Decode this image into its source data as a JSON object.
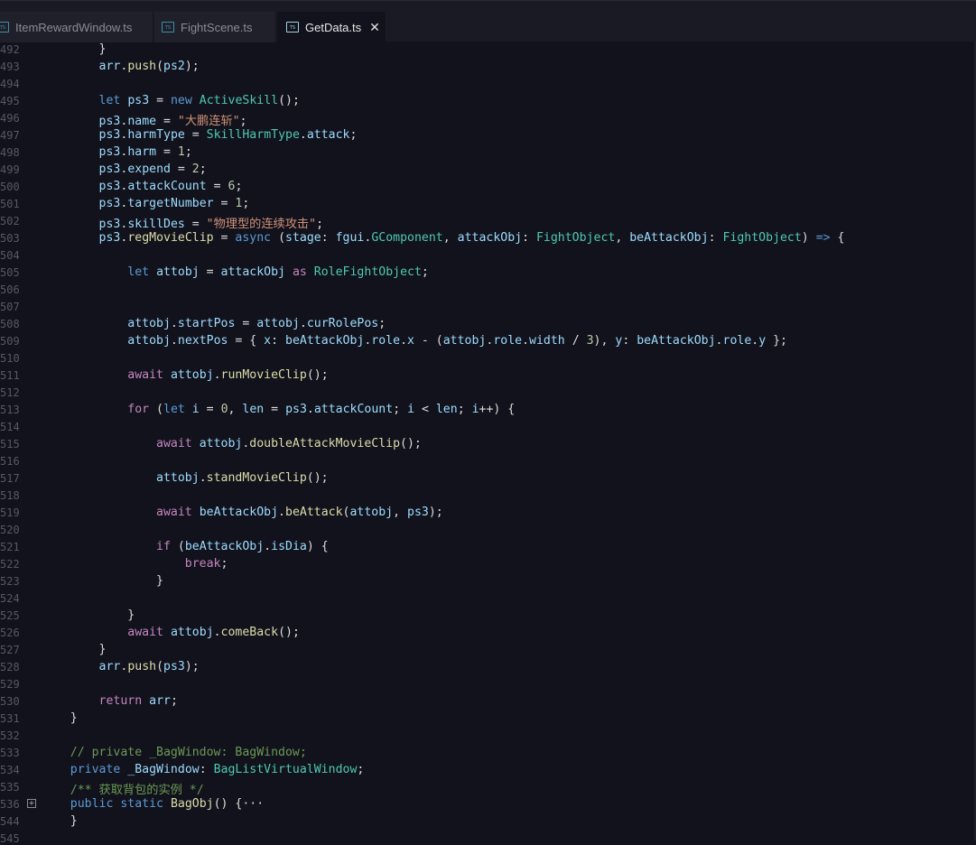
{
  "tabs": [
    {
      "label": "ItemRewardWindow.ts",
      "active": false
    },
    {
      "label": "FightScene.ts",
      "active": false
    },
    {
      "label": "GetData.ts",
      "active": true
    }
  ],
  "tab_icon_text": "TS",
  "close_symbol": "✕",
  "colors": {
    "background": "#12121c",
    "keyword": "#5b9bd5",
    "control": "#c586c0",
    "function": "#dcdcaa",
    "type": "#4ec9b0",
    "string": "#ce9178",
    "number": "#b5cea8",
    "comment": "#6a9955",
    "variable": "#9cdcfe"
  },
  "lines": [
    {
      "n": "492",
      "t": [
        [
          "pl",
          "        }"
        ]
      ]
    },
    {
      "n": "493",
      "t": [
        [
          "pl",
          "        "
        ],
        [
          "vr",
          "arr"
        ],
        [
          "pl",
          "."
        ],
        [
          "fn",
          "push"
        ],
        [
          "pl",
          "("
        ],
        [
          "vr",
          "ps2"
        ],
        [
          "pl",
          ");"
        ]
      ]
    },
    {
      "n": "494",
      "t": []
    },
    {
      "n": "495",
      "t": [
        [
          "pl",
          "        "
        ],
        [
          "kw",
          "let"
        ],
        [
          "pl",
          " "
        ],
        [
          "vr",
          "ps3"
        ],
        [
          "pl",
          " = "
        ],
        [
          "kw",
          "new"
        ],
        [
          "pl",
          " "
        ],
        [
          "ty",
          "ActiveSkill"
        ],
        [
          "pl",
          "();"
        ]
      ]
    },
    {
      "n": "496",
      "t": [
        [
          "pl",
          "        "
        ],
        [
          "vr",
          "ps3"
        ],
        [
          "pl",
          "."
        ],
        [
          "vr",
          "name"
        ],
        [
          "pl",
          " = "
        ],
        [
          "str",
          "\"大鹏连斩\""
        ],
        [
          "pl",
          ";"
        ]
      ]
    },
    {
      "n": "497",
      "t": [
        [
          "pl",
          "        "
        ],
        [
          "vr",
          "ps3"
        ],
        [
          "pl",
          "."
        ],
        [
          "vr",
          "harmType"
        ],
        [
          "pl",
          " = "
        ],
        [
          "ty",
          "SkillHarmType"
        ],
        [
          "pl",
          "."
        ],
        [
          "vr",
          "attack"
        ],
        [
          "pl",
          ";"
        ]
      ]
    },
    {
      "n": "498",
      "t": [
        [
          "pl",
          "        "
        ],
        [
          "vr",
          "ps3"
        ],
        [
          "pl",
          "."
        ],
        [
          "vr",
          "harm"
        ],
        [
          "pl",
          " = "
        ],
        [
          "num",
          "1"
        ],
        [
          "pl",
          ";"
        ]
      ]
    },
    {
      "n": "499",
      "t": [
        [
          "pl",
          "        "
        ],
        [
          "vr",
          "ps3"
        ],
        [
          "pl",
          "."
        ],
        [
          "vr",
          "expend"
        ],
        [
          "pl",
          " = "
        ],
        [
          "num",
          "2"
        ],
        [
          "pl",
          ";"
        ]
      ]
    },
    {
      "n": "500",
      "t": [
        [
          "pl",
          "        "
        ],
        [
          "vr",
          "ps3"
        ],
        [
          "pl",
          "."
        ],
        [
          "vr",
          "attackCount"
        ],
        [
          "pl",
          " = "
        ],
        [
          "num",
          "6"
        ],
        [
          "pl",
          ";"
        ]
      ]
    },
    {
      "n": "501",
      "t": [
        [
          "pl",
          "        "
        ],
        [
          "vr",
          "ps3"
        ],
        [
          "pl",
          "."
        ],
        [
          "vr",
          "targetNumber"
        ],
        [
          "pl",
          " = "
        ],
        [
          "num",
          "1"
        ],
        [
          "pl",
          ";"
        ]
      ]
    },
    {
      "n": "502",
      "t": [
        [
          "pl",
          "        "
        ],
        [
          "vr",
          "ps3"
        ],
        [
          "pl",
          "."
        ],
        [
          "vr",
          "skillDes"
        ],
        [
          "pl",
          " = "
        ],
        [
          "str",
          "\"物理型的连续攻击\""
        ],
        [
          "pl",
          ";"
        ]
      ]
    },
    {
      "n": "503",
      "t": [
        [
          "pl",
          "        "
        ],
        [
          "vr",
          "ps3"
        ],
        [
          "pl",
          "."
        ],
        [
          "fn",
          "regMovieClip"
        ],
        [
          "pl",
          " = "
        ],
        [
          "kw",
          "async"
        ],
        [
          "pl",
          " ("
        ],
        [
          "vr",
          "stage"
        ],
        [
          "pl",
          ": "
        ],
        [
          "vr",
          "fgui"
        ],
        [
          "pl",
          "."
        ],
        [
          "ty",
          "GComponent"
        ],
        [
          "pl",
          ", "
        ],
        [
          "vr",
          "attackObj"
        ],
        [
          "pl",
          ": "
        ],
        [
          "ty",
          "FightObject"
        ],
        [
          "pl",
          ", "
        ],
        [
          "vr",
          "beAttackObj"
        ],
        [
          "pl",
          ": "
        ],
        [
          "ty",
          "FightObject"
        ],
        [
          "pl",
          ") "
        ],
        [
          "kw",
          "=>"
        ],
        [
          "pl",
          " {"
        ]
      ]
    },
    {
      "n": "504",
      "t": []
    },
    {
      "n": "505",
      "t": [
        [
          "pl",
          "            "
        ],
        [
          "kw",
          "let"
        ],
        [
          "pl",
          " "
        ],
        [
          "vr",
          "attobj"
        ],
        [
          "pl",
          " = "
        ],
        [
          "vr",
          "attackObj"
        ],
        [
          "pl",
          " "
        ],
        [
          "ctl",
          "as"
        ],
        [
          "pl",
          " "
        ],
        [
          "ty",
          "RoleFightObject"
        ],
        [
          "pl",
          ";"
        ]
      ]
    },
    {
      "n": "506",
      "t": []
    },
    {
      "n": "507",
      "t": []
    },
    {
      "n": "508",
      "t": [
        [
          "pl",
          "            "
        ],
        [
          "vr",
          "attobj"
        ],
        [
          "pl",
          "."
        ],
        [
          "vr",
          "startPos"
        ],
        [
          "pl",
          " = "
        ],
        [
          "vr",
          "attobj"
        ],
        [
          "pl",
          "."
        ],
        [
          "vr",
          "curRolePos"
        ],
        [
          "pl",
          ";"
        ]
      ]
    },
    {
      "n": "509",
      "t": [
        [
          "pl",
          "            "
        ],
        [
          "vr",
          "attobj"
        ],
        [
          "pl",
          "."
        ],
        [
          "vr",
          "nextPos"
        ],
        [
          "pl",
          " = { "
        ],
        [
          "vr",
          "x"
        ],
        [
          "pl",
          ": "
        ],
        [
          "vr",
          "beAttackObj"
        ],
        [
          "pl",
          "."
        ],
        [
          "vr",
          "role"
        ],
        [
          "pl",
          "."
        ],
        [
          "vr",
          "x"
        ],
        [
          "pl",
          " - ("
        ],
        [
          "vr",
          "attobj"
        ],
        [
          "pl",
          "."
        ],
        [
          "vr",
          "role"
        ],
        [
          "pl",
          "."
        ],
        [
          "vr",
          "width"
        ],
        [
          "pl",
          " / "
        ],
        [
          "num",
          "3"
        ],
        [
          "pl",
          "), "
        ],
        [
          "vr",
          "y"
        ],
        [
          "pl",
          ": "
        ],
        [
          "vr",
          "beAttackObj"
        ],
        [
          "pl",
          "."
        ],
        [
          "vr",
          "role"
        ],
        [
          "pl",
          "."
        ],
        [
          "vr",
          "y"
        ],
        [
          "pl",
          " };"
        ]
      ]
    },
    {
      "n": "510",
      "t": []
    },
    {
      "n": "511",
      "t": [
        [
          "pl",
          "            "
        ],
        [
          "ctl",
          "await"
        ],
        [
          "pl",
          " "
        ],
        [
          "vr",
          "attobj"
        ],
        [
          "pl",
          "."
        ],
        [
          "fn",
          "runMovieClip"
        ],
        [
          "pl",
          "();"
        ]
      ]
    },
    {
      "n": "512",
      "t": []
    },
    {
      "n": "513",
      "t": [
        [
          "pl",
          "            "
        ],
        [
          "ctl",
          "for"
        ],
        [
          "pl",
          " ("
        ],
        [
          "kw",
          "let"
        ],
        [
          "pl",
          " "
        ],
        [
          "vr",
          "i"
        ],
        [
          "pl",
          " = "
        ],
        [
          "num",
          "0"
        ],
        [
          "pl",
          ", "
        ],
        [
          "vr",
          "len"
        ],
        [
          "pl",
          " = "
        ],
        [
          "vr",
          "ps3"
        ],
        [
          "pl",
          "."
        ],
        [
          "vr",
          "attackCount"
        ],
        [
          "pl",
          "; "
        ],
        [
          "vr",
          "i"
        ],
        [
          "pl",
          " < "
        ],
        [
          "vr",
          "len"
        ],
        [
          "pl",
          "; "
        ],
        [
          "vr",
          "i"
        ],
        [
          "pl",
          "++) {"
        ]
      ]
    },
    {
      "n": "514",
      "t": []
    },
    {
      "n": "515",
      "t": [
        [
          "pl",
          "                "
        ],
        [
          "ctl",
          "await"
        ],
        [
          "pl",
          " "
        ],
        [
          "vr",
          "attobj"
        ],
        [
          "pl",
          "."
        ],
        [
          "fn",
          "doubleAttackMovieClip"
        ],
        [
          "pl",
          "();"
        ]
      ]
    },
    {
      "n": "516",
      "t": []
    },
    {
      "n": "517",
      "t": [
        [
          "pl",
          "                "
        ],
        [
          "vr",
          "attobj"
        ],
        [
          "pl",
          "."
        ],
        [
          "fn",
          "standMovieClip"
        ],
        [
          "pl",
          "();"
        ]
      ]
    },
    {
      "n": "518",
      "t": []
    },
    {
      "n": "519",
      "t": [
        [
          "pl",
          "                "
        ],
        [
          "ctl",
          "await"
        ],
        [
          "pl",
          " "
        ],
        [
          "vr",
          "beAttackObj"
        ],
        [
          "pl",
          "."
        ],
        [
          "fn",
          "beAttack"
        ],
        [
          "pl",
          "("
        ],
        [
          "vr",
          "attobj"
        ],
        [
          "pl",
          ", "
        ],
        [
          "vr",
          "ps3"
        ],
        [
          "pl",
          ");"
        ]
      ]
    },
    {
      "n": "520",
      "t": []
    },
    {
      "n": "521",
      "t": [
        [
          "pl",
          "                "
        ],
        [
          "ctl",
          "if"
        ],
        [
          "pl",
          " ("
        ],
        [
          "vr",
          "beAttackObj"
        ],
        [
          "pl",
          "."
        ],
        [
          "vr",
          "isDia"
        ],
        [
          "pl",
          ") {"
        ]
      ]
    },
    {
      "n": "522",
      "t": [
        [
          "pl",
          "                    "
        ],
        [
          "ctl",
          "break"
        ],
        [
          "pl",
          ";"
        ]
      ]
    },
    {
      "n": "523",
      "t": [
        [
          "pl",
          "                }"
        ]
      ]
    },
    {
      "n": "524",
      "t": []
    },
    {
      "n": "525",
      "t": [
        [
          "pl",
          "            }"
        ]
      ]
    },
    {
      "n": "526",
      "t": [
        [
          "pl",
          "            "
        ],
        [
          "ctl",
          "await"
        ],
        [
          "pl",
          " "
        ],
        [
          "vr",
          "attobj"
        ],
        [
          "pl",
          "."
        ],
        [
          "fn",
          "comeBack"
        ],
        [
          "pl",
          "();"
        ]
      ]
    },
    {
      "n": "527",
      "t": [
        [
          "pl",
          "        }"
        ]
      ]
    },
    {
      "n": "528",
      "t": [
        [
          "pl",
          "        "
        ],
        [
          "vr",
          "arr"
        ],
        [
          "pl",
          "."
        ],
        [
          "fn",
          "push"
        ],
        [
          "pl",
          "("
        ],
        [
          "vr",
          "ps3"
        ],
        [
          "pl",
          ");"
        ]
      ]
    },
    {
      "n": "529",
      "t": []
    },
    {
      "n": "530",
      "t": [
        [
          "pl",
          "        "
        ],
        [
          "ctl",
          "return"
        ],
        [
          "pl",
          " "
        ],
        [
          "vr",
          "arr"
        ],
        [
          "pl",
          ";"
        ]
      ]
    },
    {
      "n": "531",
      "t": [
        [
          "pl",
          "    }"
        ]
      ]
    },
    {
      "n": "532",
      "t": []
    },
    {
      "n": "533",
      "t": [
        [
          "pl",
          "    "
        ],
        [
          "cm",
          "// private _BagWindow: BagWindow;"
        ]
      ]
    },
    {
      "n": "534",
      "t": [
        [
          "pl",
          "    "
        ],
        [
          "kw",
          "private"
        ],
        [
          "pl",
          " "
        ],
        [
          "vr",
          "_BagWindow"
        ],
        [
          "pl",
          ": "
        ],
        [
          "ty",
          "BagListVirtualWindow"
        ],
        [
          "pl",
          ";"
        ]
      ]
    },
    {
      "n": "535",
      "t": [
        [
          "pl",
          "    "
        ],
        [
          "cm",
          "/** 获取背包的实例 */"
        ]
      ]
    },
    {
      "n": "536",
      "t": [
        [
          "pl",
          "    "
        ],
        [
          "kw",
          "public"
        ],
        [
          "pl",
          " "
        ],
        [
          "kw",
          "static"
        ],
        [
          "pl",
          " "
        ],
        [
          "fn",
          "BagObj"
        ],
        [
          "pl",
          "() {"
        ],
        [
          "pl",
          "···"
        ]
      ]
    },
    {
      "n": "544",
      "t": [
        [
          "pl",
          "    }"
        ]
      ]
    },
    {
      "n": "545",
      "t": []
    }
  ]
}
